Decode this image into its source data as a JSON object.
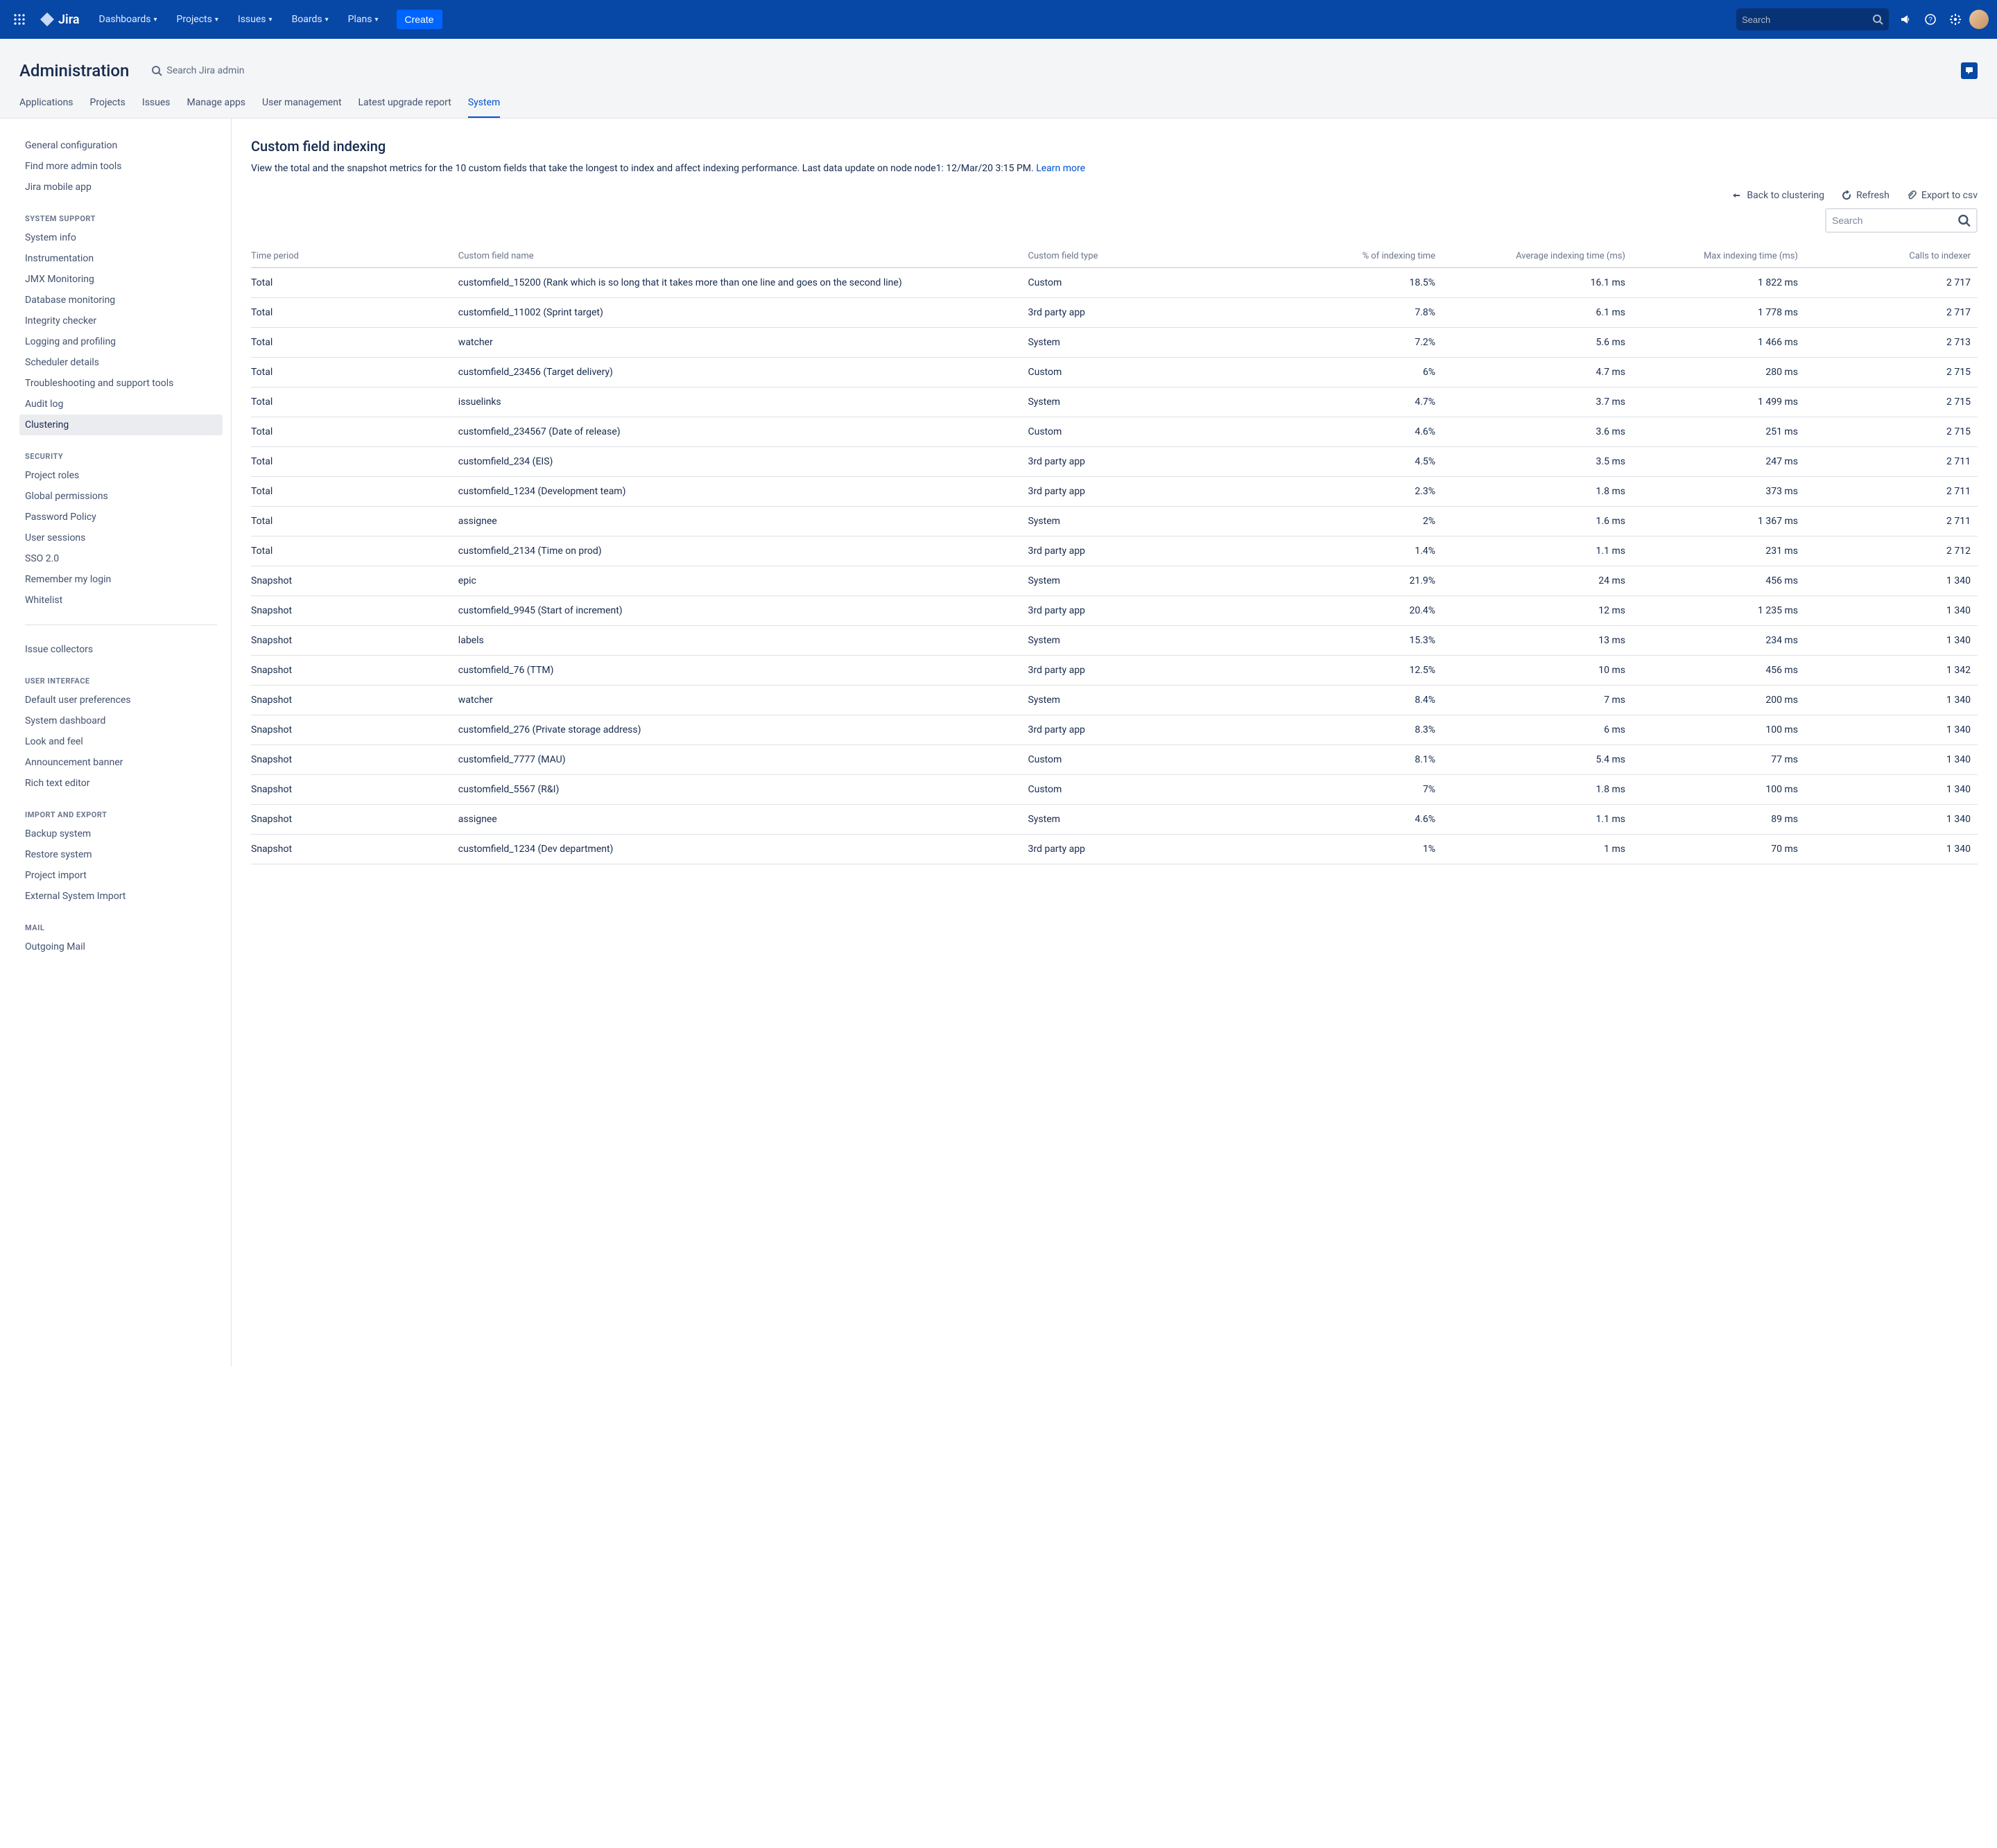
{
  "topnav": {
    "product": "Jira",
    "items": [
      "Dashboards",
      "Projects",
      "Issues",
      "Boards",
      "Plans"
    ],
    "create": "Create",
    "search_placeholder": "Search"
  },
  "subheader": {
    "title": "Administration",
    "search_label": "Search Jira admin"
  },
  "tabs": {
    "items": [
      "Applications",
      "Projects",
      "Issues",
      "Manage apps",
      "User management",
      "Latest upgrade report",
      "System"
    ],
    "activeIndex": 6
  },
  "sidebar": {
    "general": [
      "General configuration",
      "Find more admin tools",
      "Jira mobile app"
    ],
    "h_system_support": "SYSTEM SUPPORT",
    "system_support": [
      "System info",
      "Instrumentation",
      "JMX Monitoring",
      "Database monitoring",
      "Integrity checker",
      "Logging and profiling",
      "Scheduler details",
      "Troubleshooting and support tools",
      "Audit log",
      "Clustering"
    ],
    "system_support_active": 9,
    "h_security": "SECURITY",
    "security": [
      "Project roles",
      "Global permissions",
      "Password Policy",
      "User sessions",
      "SSO 2.0",
      "Remember my login",
      "Whitelist"
    ],
    "issue_collectors": "Issue collectors",
    "h_user_interface": "USER INTERFACE",
    "user_interface": [
      "Default user preferences",
      "System dashboard",
      "Look and feel",
      "Announcement banner",
      "Rich text editor"
    ],
    "h_import_export": "IMPORT AND EXPORT",
    "import_export": [
      "Backup system",
      "Restore system",
      "Project import",
      "External System Import"
    ],
    "h_mail": "MAIL",
    "mail": [
      "Outgoing Mail"
    ]
  },
  "page": {
    "title": "Custom field indexing",
    "desc_a": "View the total and the snapshot metrics for the 10 custom fields that take the longest to index and affect indexing performance. Last data update on node node1: 12/Mar/20 3:15 PM. ",
    "learn_more": "Learn more",
    "actions": {
      "back": "Back to clustering",
      "refresh": "Refresh",
      "export": "Export to csv"
    },
    "table_search_placeholder": "Search"
  },
  "table": {
    "headers": {
      "period": "Time period",
      "name": "Custom field name",
      "type": "Custom field type",
      "pct": "% of indexing time",
      "avg": "Average indexing time (ms)",
      "max": "Max indexing time (ms)",
      "calls": "Calls to indexer"
    },
    "rows": [
      {
        "period": "Total",
        "name": "customfield_15200 (Rank which is so long that it takes more than one line and goes on the second line)",
        "type": "Custom",
        "pct": "18.5%",
        "avg": "16.1 ms",
        "max": "1 822 ms",
        "calls": "2 717"
      },
      {
        "period": "Total",
        "name": "customfield_11002 (Sprint target)",
        "type": "3rd party app",
        "pct": "7.8%",
        "avg": "6.1 ms",
        "max": "1 778 ms",
        "calls": "2 717"
      },
      {
        "period": "Total",
        "name": "watcher",
        "type": "System",
        "pct": "7.2%",
        "avg": "5.6 ms",
        "max": "1 466 ms",
        "calls": "2 713"
      },
      {
        "period": "Total",
        "name": "customfield_23456 (Target delivery)",
        "type": "Custom",
        "pct": "6%",
        "avg": "4.7 ms",
        "max": "280 ms",
        "calls": "2 715"
      },
      {
        "period": "Total",
        "name": "issuelinks",
        "type": "System",
        "pct": "4.7%",
        "avg": "3.7 ms",
        "max": "1 499 ms",
        "calls": "2 715"
      },
      {
        "period": "Total",
        "name": "customfield_234567 (Date of release)",
        "type": "Custom",
        "pct": "4.6%",
        "avg": "3.6 ms",
        "max": "251 ms",
        "calls": "2 715"
      },
      {
        "period": "Total",
        "name": "customfield_234 (EIS)",
        "type": "3rd party app",
        "pct": "4.5%",
        "avg": "3.5 ms",
        "max": "247 ms",
        "calls": "2 711"
      },
      {
        "period": "Total",
        "name": "customfield_1234 (Development team)",
        "type": "3rd party app",
        "pct": "2.3%",
        "avg": "1.8 ms",
        "max": "373 ms",
        "calls": "2 711"
      },
      {
        "period": "Total",
        "name": "assignee",
        "type": "System",
        "pct": "2%",
        "avg": "1.6 ms",
        "max": "1 367 ms",
        "calls": "2 711"
      },
      {
        "period": "Total",
        "name": "customfield_2134 (Time on prod)",
        "type": "3rd party app",
        "pct": "1.4%",
        "avg": "1.1 ms",
        "max": "231 ms",
        "calls": "2 712"
      },
      {
        "period": "Snapshot",
        "name": "epic",
        "type": "System",
        "pct": "21.9%",
        "avg": "24 ms",
        "max": "456 ms",
        "calls": "1 340"
      },
      {
        "period": "Snapshot",
        "name": "customfield_9945 (Start of increment)",
        "type": "3rd party app",
        "pct": "20.4%",
        "avg": "12 ms",
        "max": "1 235 ms",
        "calls": "1 340"
      },
      {
        "period": "Snapshot",
        "name": "labels",
        "type": "System",
        "pct": "15.3%",
        "avg": "13 ms",
        "max": "234 ms",
        "calls": "1 340"
      },
      {
        "period": "Snapshot",
        "name": "customfield_76 (TTM)",
        "type": "3rd party app",
        "pct": "12.5%",
        "avg": "10 ms",
        "max": "456 ms",
        "calls": "1 342"
      },
      {
        "period": "Snapshot",
        "name": "watcher",
        "type": "System",
        "pct": "8.4%",
        "avg": "7 ms",
        "max": "200 ms",
        "calls": "1 340"
      },
      {
        "period": "Snapshot",
        "name": "customfield_276 (Private storage address)",
        "type": "3rd party app",
        "pct": "8.3%",
        "avg": "6 ms",
        "max": "100 ms",
        "calls": "1 340"
      },
      {
        "period": "Snapshot",
        "name": "customfield_7777 (MAU)",
        "type": "Custom",
        "pct": "8.1%",
        "avg": "5.4 ms",
        "max": "77 ms",
        "calls": "1 340"
      },
      {
        "period": "Snapshot",
        "name": "customfield_5567 (R&I)",
        "type": "Custom",
        "pct": "7%",
        "avg": "1.8 ms",
        "max": "100 ms",
        "calls": "1 340"
      },
      {
        "period": "Snapshot",
        "name": "assignee",
        "type": "System",
        "pct": "4.6%",
        "avg": "1.1 ms",
        "max": "89 ms",
        "calls": "1 340"
      },
      {
        "period": "Snapshot",
        "name": "customfield_1234 (Dev department)",
        "type": "3rd party app",
        "pct": "1%",
        "avg": "1 ms",
        "max": "70 ms",
        "calls": "1 340"
      }
    ]
  }
}
